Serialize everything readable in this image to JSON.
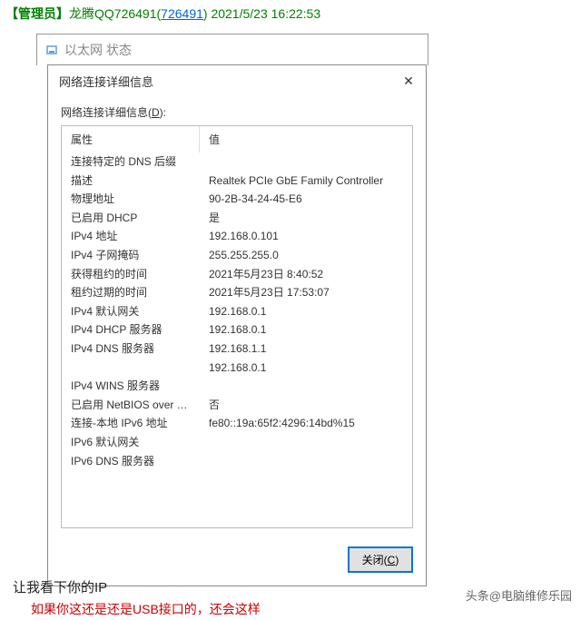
{
  "chat": {
    "role_prefix": "【管理员】",
    "name": "龙腾QQ726491(",
    "qq": "726491",
    "name_suffix": ") ",
    "timestamp": "2021/5/23 16:22:53",
    "bottom_msg": "让我看下你的IP",
    "last_line": "如果你这还是还是USB接口的，还会这样"
  },
  "outer": {
    "title": "以太网 状态"
  },
  "inner": {
    "title": "网络连接详细信息",
    "group_label_pre": "网络连接详细信息(",
    "group_label_ul": "D",
    "group_label_post": "):",
    "col_property": "属性",
    "col_value": "值",
    "close_label_pre": "关闭(",
    "close_label_ul": "C",
    "close_label_post": ")"
  },
  "rows": [
    {
      "name": "连接特定的 DNS 后缀",
      "value": ""
    },
    {
      "name": "描述",
      "value": "Realtek PCIe GbE Family Controller"
    },
    {
      "name": "物理地址",
      "value": "90-2B-34-24-45-E6"
    },
    {
      "name": "已启用 DHCP",
      "value": "是"
    },
    {
      "name": "IPv4 地址",
      "value": "192.168.0.101"
    },
    {
      "name": "IPv4 子网掩码",
      "value": "255.255.255.0"
    },
    {
      "name": "获得租约的时间",
      "value": "2021年5月23日 8:40:52"
    },
    {
      "name": "租约过期的时间",
      "value": "2021年5月23日 17:53:07"
    },
    {
      "name": "IPv4 默认网关",
      "value": "192.168.0.1"
    },
    {
      "name": "IPv4 DHCP 服务器",
      "value": "192.168.0.1"
    },
    {
      "name": "IPv4 DNS 服务器",
      "value": "192.168.1.1"
    },
    {
      "name": "",
      "value": "192.168.0.1"
    },
    {
      "name": "IPv4 WINS 服务器",
      "value": ""
    },
    {
      "name": "已启用 NetBIOS over Tc...",
      "value": "否"
    },
    {
      "name": "连接-本地 IPv6 地址",
      "value": "fe80::19a:65f2:4296:14bd%15"
    },
    {
      "name": "IPv6 默认网关",
      "value": ""
    },
    {
      "name": "IPv6 DNS 服务器",
      "value": ""
    }
  ],
  "watermark": "头条@电脑维修乐园"
}
